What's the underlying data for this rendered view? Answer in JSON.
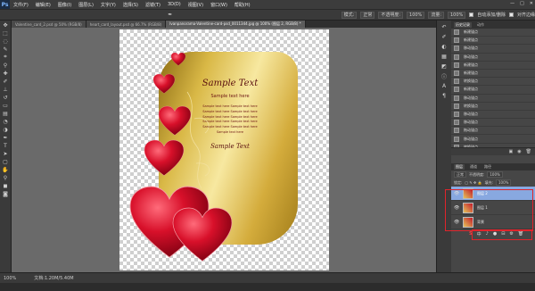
{
  "app": {
    "logo": "Ps"
  },
  "menu": [
    "文件(F)",
    "编辑(E)",
    "图像(I)",
    "图层(L)",
    "文字(Y)",
    "选择(S)",
    "滤镜(T)",
    "3D(D)",
    "视图(V)",
    "窗口(W)",
    "帮助(H)"
  ],
  "window_controls": {
    "minimize": "—",
    "maximize": "□",
    "close": "✕"
  },
  "options": {
    "mode_label": "模式:",
    "mode_value": "正常",
    "opacity_label": "不透明度:",
    "opacity_value": "100%",
    "flow_label": "流量:",
    "flow_value": "100%",
    "checkbox_label": "自动添加/删除",
    "align_label": "对齐边缘"
  },
  "doc_tabs": [
    {
      "label": "Valentine_card_2.psd @ 50% (RGB/8)"
    },
    {
      "label": "heart_card_layout.psd @ 66.7% (RGB/8)"
    },
    {
      "label": "Ivanpanorama-Valentine-card-psd_0011344.jpg @ 100% (图层 2, RGB/8) *"
    }
  ],
  "card": {
    "title": "Sample Text",
    "subtitle": "Sample text here",
    "body": [
      "Sample text here Sample text here",
      "Sample text here Sample text here",
      "Sample text here Sample text here",
      "Sample text here Sample text here",
      "Sample text here Sample text here",
      "Sample text here"
    ],
    "signature": "Sample Text"
  },
  "status": {
    "zoom": "100%",
    "doc_size": "文档:1.20M/5.40M"
  },
  "history_panel": {
    "tabs": [
      "历史记录",
      "动作"
    ],
    "items": [
      "新建锚点",
      "新建锚点",
      "移动锚点",
      "移动锚点",
      "新建锚点",
      "新建锚点",
      "转换锚点",
      "新建锚点",
      "移动锚点",
      "转换锚点",
      "移动锚点",
      "移动锚点",
      "拖动锚点",
      "移动锚点",
      "转换锚点",
      "建立选区",
      "通过拷贝的图层"
    ],
    "selected_index": 16
  },
  "layers_panel": {
    "tabs": [
      "图层",
      "通道",
      "路径"
    ],
    "blend_mode": "正常",
    "opacity_label": "不透明度:",
    "opacity_value": "100%",
    "lock_label": "锁定:",
    "fill_label": "填充:",
    "fill_value": "100%",
    "layers": [
      {
        "name": "图层 2",
        "selected": true
      },
      {
        "name": "图层 1",
        "selected": false
      },
      {
        "name": "背景",
        "selected": false
      }
    ],
    "bottom_icons": [
      "S",
      "中",
      "♪",
      "●",
      "⊟",
      "⚙",
      "🗑"
    ]
  },
  "colors": {
    "accent_selection": "#6c8cc6",
    "highlight_box": "#e0242b",
    "heart": "#c8102e",
    "gold": "#e6c35a"
  }
}
